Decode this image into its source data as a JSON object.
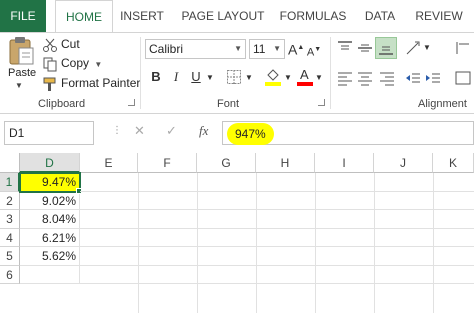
{
  "ribbon_tabs": [
    "FILE",
    "HOME",
    "INSERT",
    "PAGE LAYOUT",
    "FORMULAS",
    "DATA",
    "REVIEW"
  ],
  "active_tab": "HOME",
  "clipboard": {
    "paste": "Paste",
    "cut": "Cut",
    "copy": "Copy",
    "format_painter": "Format Painter",
    "group_label": "Clipboard"
  },
  "font": {
    "name": "Calibri",
    "size": "11",
    "bold": "B",
    "italic": "I",
    "underline": "U",
    "grow": "A",
    "shrink": "A",
    "group_label": "Font"
  },
  "alignment": {
    "group_label": "Alignment"
  },
  "formula_bar": {
    "name_box": "D1",
    "cancel_glyph": "✕",
    "enter_glyph": "✓",
    "fx_label": "fx",
    "value": "947%"
  },
  "sheet": {
    "columns": [
      "D",
      "E",
      "F",
      "G",
      "H",
      "I",
      "J",
      "K"
    ],
    "selected_column": "D",
    "rows": [
      "1",
      "2",
      "3",
      "4",
      "5",
      "6"
    ],
    "selected_row": "1",
    "column_d_values": [
      "9.47%",
      "9.02%",
      "8.04%",
      "6.21%",
      "5.62%",
      ""
    ],
    "active_cell": "D1"
  },
  "colors": {
    "excel_green": "#217346",
    "highlight_yellow": "#ffff00",
    "font_color_red": "#ff0000"
  }
}
